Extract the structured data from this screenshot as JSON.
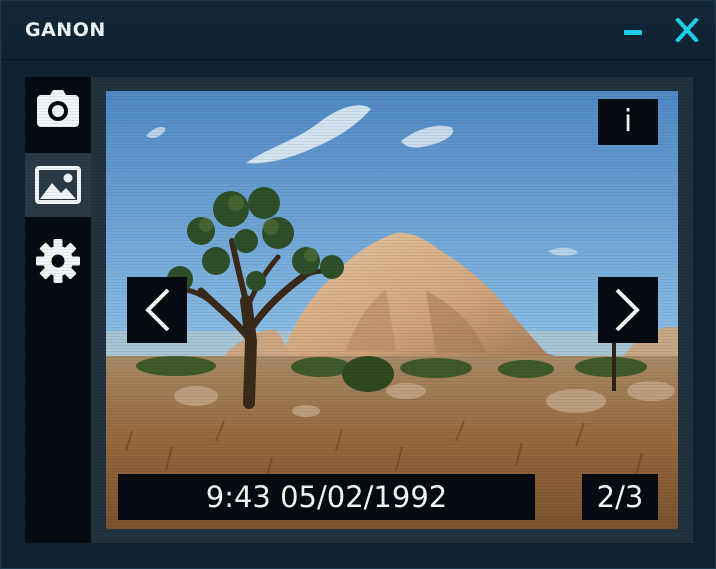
{
  "window": {
    "title": "GANON",
    "minimize_icon": "minimize-icon",
    "close_icon": "close-icon",
    "accent_color": "#1ed2ee"
  },
  "sidebar": {
    "items": [
      {
        "icon": "camera-icon",
        "active": false
      },
      {
        "icon": "image-icon",
        "active": true
      },
      {
        "icon": "gear-icon",
        "active": false
      }
    ]
  },
  "viewer": {
    "info_label": "i",
    "prev_icon": "chevron-left-icon",
    "next_icon": "chevron-right-icon",
    "timestamp": "9:43 05/02/1992",
    "counter": "2/3",
    "photo_subject": "desert landscape with joshua tree and granite boulder"
  }
}
